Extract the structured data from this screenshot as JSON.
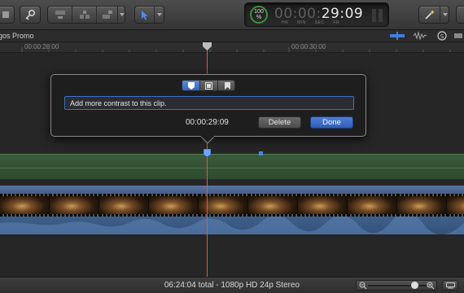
{
  "toolbar": {
    "timecode": {
      "meter_value": "100",
      "meter_unit": "%",
      "dim_part": "00:00:",
      "lit_part": "29:09",
      "units": "HR MIN SEC FR"
    }
  },
  "timeline": {
    "project_title": "gos Promo",
    "ruler": {
      "label_left": "00:00:28:00",
      "label_right": "00:00:30:00"
    }
  },
  "popover": {
    "note_value": "Add more contrast to this clip.",
    "time": "00:00:29:09",
    "delete_label": "Delete",
    "done_label": "Done",
    "tabs": [
      "marker",
      "todo",
      "chapter"
    ],
    "active_tab": "marker"
  },
  "status": {
    "text": "06:24:04 total - 1080p HD 24p Stereo"
  },
  "colors": {
    "accent": "#3f6fc7",
    "playhead": "#e05a4a",
    "done_button": "#3563c0",
    "green_track": "#3b5a3b",
    "blue_track": "#455f88"
  }
}
